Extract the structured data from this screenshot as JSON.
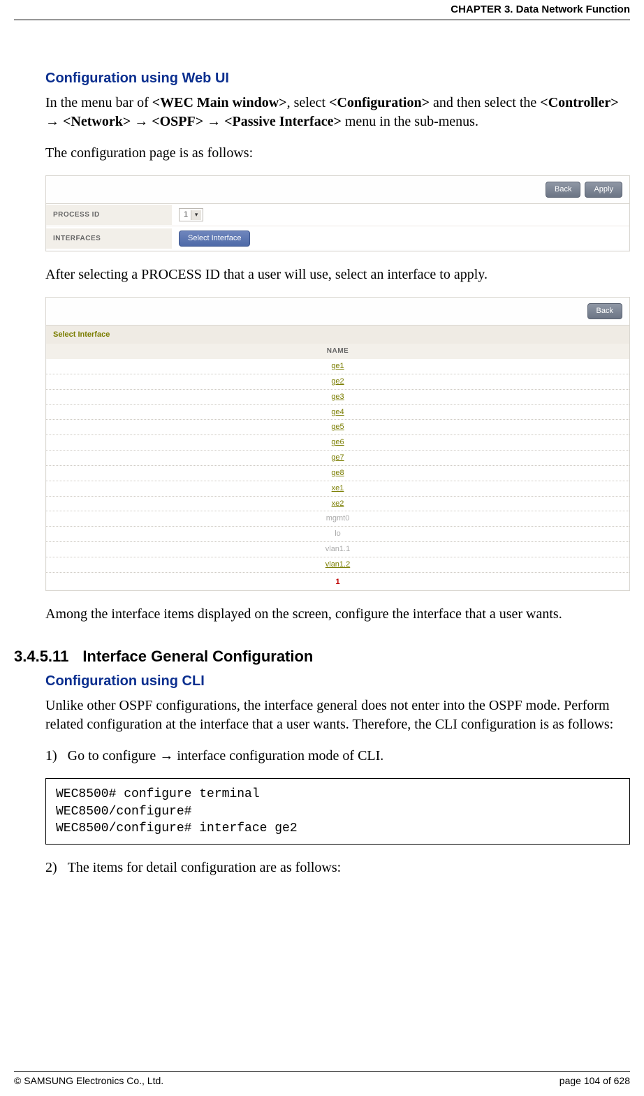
{
  "header": {
    "chapter": "CHAPTER 3. Data Network Function"
  },
  "sec1": {
    "title": "Configuration using Web UI",
    "lead_a": "In the menu bar of ",
    "bold1": "<WEC Main window>",
    "lead_b": ", select ",
    "bold2": "<Configuration>",
    "lead_c": " and then select the ",
    "bold3": "<Controller>",
    "arrow": " → ",
    "bold4": "<Network>",
    "bold5": "<OSPF>",
    "bold6": "<Passive Interface>",
    "lead_d": " menu in the sub-menus.",
    "line2": "The configuration page is as follows:"
  },
  "panel1": {
    "back": "Back",
    "apply": "Apply",
    "row1_label": "PROCESS ID",
    "process_id_value": "1",
    "row2_label": "INTERFACES",
    "select_iface_btn": "Select Interface"
  },
  "mid_line": "After selecting a PROCESS ID that a user will use, select an interface to apply.",
  "panel2": {
    "back": "Back",
    "title": "Select Interface",
    "col": "NAME",
    "items": [
      {
        "label": "ge1",
        "link": true
      },
      {
        "label": "ge2",
        "link": true
      },
      {
        "label": "ge3",
        "link": true
      },
      {
        "label": "ge4",
        "link": true
      },
      {
        "label": "ge5",
        "link": true
      },
      {
        "label": "ge6",
        "link": true
      },
      {
        "label": "ge7",
        "link": true
      },
      {
        "label": "ge8",
        "link": true
      },
      {
        "label": "xe1",
        "link": true
      },
      {
        "label": "xe2",
        "link": true
      },
      {
        "label": "mgmt0",
        "link": false
      },
      {
        "label": "lo",
        "link": false
      },
      {
        "label": "vlan1.1",
        "link": false
      },
      {
        "label": "vlan1.2",
        "link": true
      }
    ],
    "pager": "1"
  },
  "after_table": "Among the interface items displayed on the screen, configure the interface that a user wants.",
  "sec2": {
    "num": "3.4.5.11",
    "title": "Interface General Configuration",
    "subtitle": "Configuration using CLI",
    "para": "Unlike other OSPF configurations, the interface general does not enter into the OSPF mode. Perform related configuration at the interface that a user wants. Therefore, the CLI configuration is as follows:",
    "step1_a": "Go to configure ",
    "step1_arrow": "→",
    "step1_b": " interface configuration mode of CLI.",
    "cli": "WEC8500# configure terminal\nWEC8500/configure# \nWEC8500/configure# interface ge2",
    "step2": "The items for detail configuration are as follows:"
  },
  "footer": {
    "left": "© SAMSUNG Electronics Co., Ltd.",
    "right": "page 104 of 628"
  }
}
